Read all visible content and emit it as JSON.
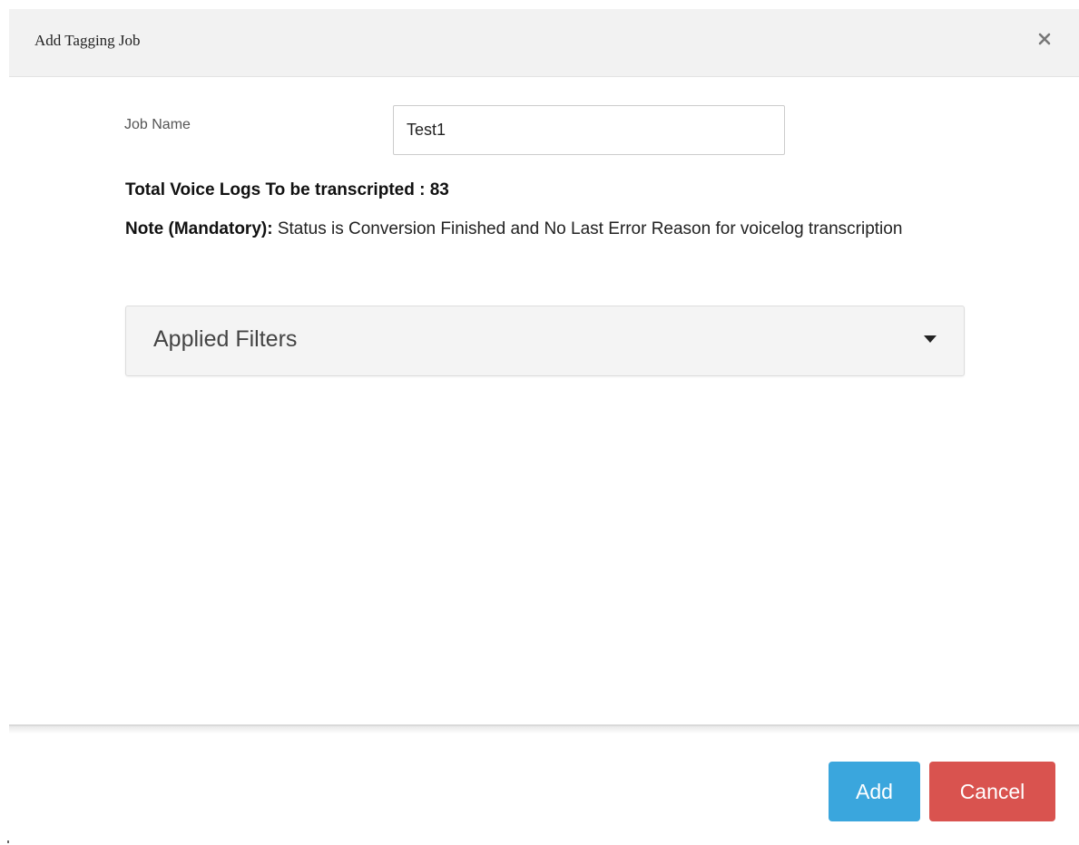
{
  "dialog": {
    "title": "Add Tagging Job",
    "close_icon": "close-icon"
  },
  "form": {
    "job_name_label": "Job Name",
    "job_name_value": "Test1"
  },
  "summary": {
    "total_line": "Total Voice Logs To be transcripted :  83",
    "note_label": "Note (Mandatory):",
    "note_text": "Status is Conversion Finished and No Last Error Reason for voicelog transcription"
  },
  "filters": {
    "title": "Applied Filters",
    "caret_icon": "caret-down-icon",
    "expanded": false
  },
  "footer": {
    "add_label": "Add",
    "cancel_label": "Cancel"
  },
  "colors": {
    "add_button": "#3aa6dd",
    "cancel_button": "#d9534f",
    "header_bg": "#f2f2f2",
    "panel_bg": "#f4f4f4"
  }
}
